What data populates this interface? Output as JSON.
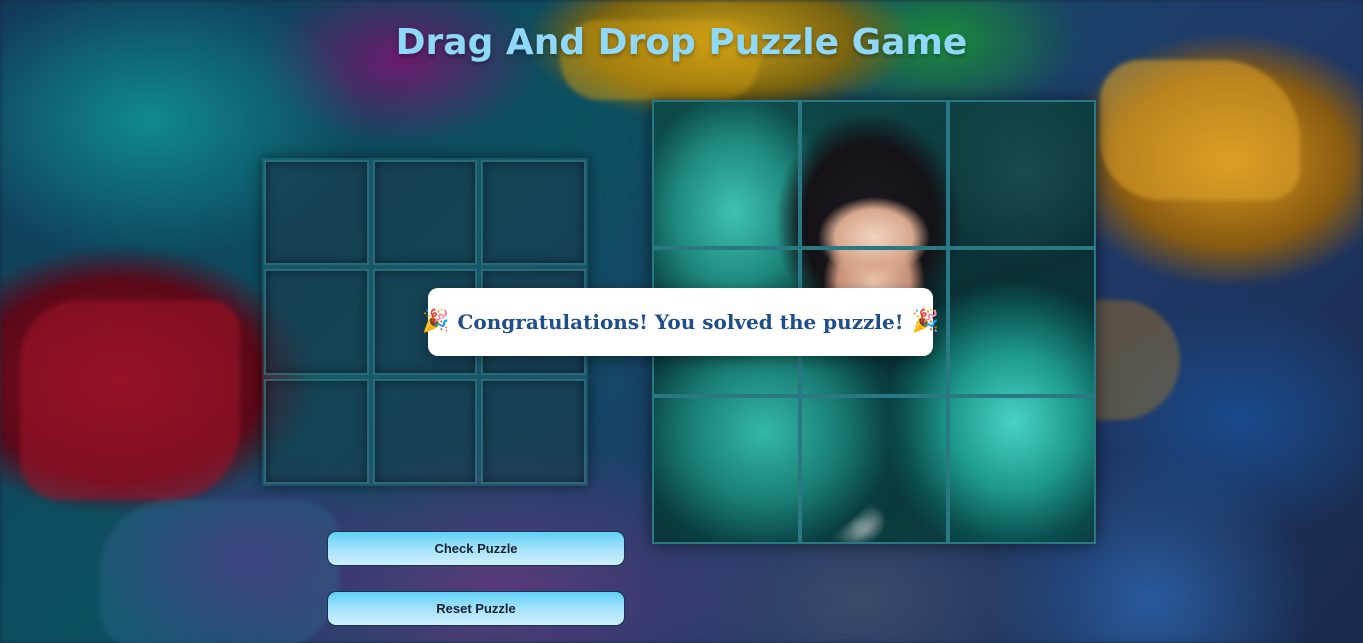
{
  "page": {
    "title": "Drag And Drop Puzzle Game"
  },
  "source_grid": {
    "slots": 9
  },
  "board": {
    "rows": 3,
    "cols": 3,
    "image": "teal-dragon-girl-artwork"
  },
  "modal": {
    "icon_left": "🎉",
    "message": "Congratulations! You solved the puzzle!",
    "icon_right": "🎉"
  },
  "buttons": {
    "check_label": "Check Puzzle",
    "reset_label": "Reset Puzzle"
  },
  "colors": {
    "title": "#8fd8f7",
    "modal_text": "#1e4f8a",
    "button_top": "#5fd0f6"
  }
}
